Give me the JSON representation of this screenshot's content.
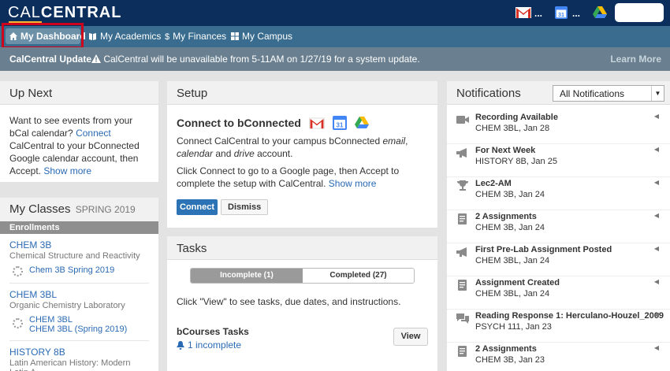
{
  "header": {
    "logo_cal": "CAL",
    "logo_central": "CENTRAL",
    "gmail_dots": "...",
    "calendar_dots": "...",
    "calendar_icon_text": "31"
  },
  "nav": {
    "items": [
      {
        "label": "My Dashboard",
        "icon": "home-icon"
      },
      {
        "label": "My Academics",
        "icon": "book-icon"
      },
      {
        "label": "My Finances",
        "icon": "dollar-icon"
      },
      {
        "label": "My Campus",
        "icon": "grid-icon"
      }
    ]
  },
  "banner": {
    "title": "CalCentral Update",
    "message": "CalCentral will be unavailable from 5-11AM on 1/27/19 for a system update.",
    "more": "Learn More"
  },
  "upnext": {
    "title": "Up Next",
    "text_1": "Want to see events from your bCal calendar?",
    "connect": "Connect",
    "text_2": "CalCentral to your bConnected Google calendar account, then Accept.",
    "show_more": "Show more"
  },
  "classes": {
    "title": "My Classes",
    "term": "SPRING 2019",
    "enrollments_label": "Enrollments",
    "items": [
      {
        "code": "CHEM 3B",
        "title": "Chemical Structure and Reactivity",
        "site": "Chem 3B Spring 2019",
        "site2": ""
      },
      {
        "code": "CHEM 3BL",
        "title": "Organic Chemistry Laboratory",
        "site": "CHEM 3BL",
        "site2": "CHEM 3BL (Spring 2019)"
      },
      {
        "code": "HISTORY 8B",
        "title": "Latin American History: Modern Latin A..."
      }
    ]
  },
  "setup": {
    "title": "Setup",
    "heading": "Connect to bConnected",
    "calendar_icon_text": "31",
    "p1_a": "Connect CalCentral to your campus bConnected",
    "p1_email": "email",
    "p1_b": ",",
    "p1_calendar": "calendar",
    "p1_c": "and",
    "p1_drive": "drive",
    "p1_d": "account.",
    "p2": "Click Connect to go to a Google page, then Accept to complete the setup with CalCentral.",
    "show_more": "Show more",
    "connect_label": "Connect",
    "dismiss_label": "Dismiss"
  },
  "tasks": {
    "title": "Tasks",
    "incomplete_tab": "Incomplete (1)",
    "completed_tab": "Completed (27)",
    "hint": "Click \"View\" to see tasks, due dates, and instructions.",
    "bcourses_title": "bCourses Tasks",
    "bcourses_incomplete": "1 incomplete",
    "view_label": "View"
  },
  "notifications": {
    "title": "Notifications",
    "filter_value": "All Notifications",
    "items": [
      {
        "icon": "video-icon",
        "title": "Recording Available",
        "sub": "CHEM 3BL, Jan 28"
      },
      {
        "icon": "megaphone-icon",
        "title": "For Next Week",
        "sub": "HISTORY 8B, Jan 25"
      },
      {
        "icon": "trophy-icon",
        "title": "Lec2-AM",
        "sub": "CHEM 3B, Jan 24"
      },
      {
        "icon": "assignment-icon",
        "title": "2 Assignments",
        "sub": "CHEM 3B, Jan 24"
      },
      {
        "icon": "megaphone-icon",
        "title": "First Pre-Lab Assignment Posted",
        "sub": "CHEM 3BL, Jan 24"
      },
      {
        "icon": "assignment-icon",
        "title": "Assignment Created",
        "sub": "CHEM 3BL, Jan 24"
      },
      {
        "icon": "discussion-icon",
        "title": "Reading Response 1: Herculano-Houzel_2009",
        "sub": "PSYCH 111, Jan 23"
      },
      {
        "icon": "assignment-icon",
        "title": "2 Assignments",
        "sub": "CHEM 3B, Jan 23"
      }
    ]
  },
  "colors": {
    "header_bg": "#0b2e5c",
    "nav_bg": "#396c8e",
    "banner_bg": "#6a7f8f",
    "link": "#2a6ab5",
    "primary_button": "#2b73b5",
    "highlight_border": "#d0021b"
  }
}
